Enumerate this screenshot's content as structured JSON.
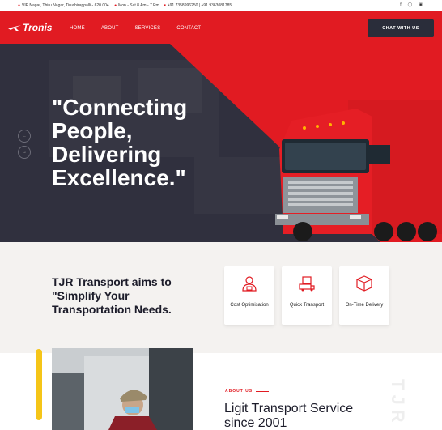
{
  "topbar": {
    "address": "VIP Nagar, Thiru Nagar, Tiruchirappalli - 620 004.",
    "hours": "Mon - Sat 8 Am - 7 Pm",
    "phone": "+91 7358996250 | +91 9363081785",
    "social": [
      "facebook-icon",
      "whatsapp-icon",
      "instagram-icon"
    ]
  },
  "nav": {
    "logo": "Tronis",
    "menu": [
      "HOME",
      "ABOUT",
      "SERVICES",
      "CONTACT"
    ],
    "cta": "CHAT WITH US"
  },
  "hero": {
    "headline": "\"Connecting People, Delivering Excellence.\"",
    "prev_arrow": "←",
    "next_arrow": "→"
  },
  "features": {
    "aim": "TJR Transport aims to \"Simplify Your Transportation Needs.",
    "cards": [
      {
        "label": "Cost Optimisation",
        "icon": "cost-optimisation-icon"
      },
      {
        "label": "Quick Transport",
        "icon": "quick-transport-icon"
      },
      {
        "label": "On-Time Delivery",
        "icon": "on-time-delivery-icon"
      }
    ]
  },
  "about": {
    "eyebrow": "ABOUT US",
    "title": "Ligit Transport Service since 2001",
    "vertical": "TJR"
  },
  "colors": {
    "brand_red": "#e11b22",
    "dark": "#2a2d3a",
    "accent_yellow": "#f5c518"
  }
}
